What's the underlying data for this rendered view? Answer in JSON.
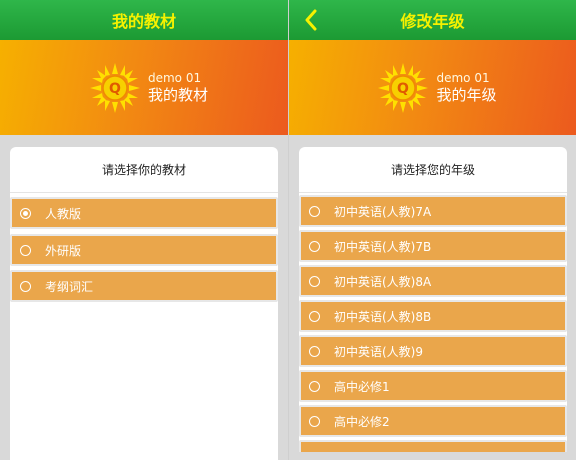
{
  "left": {
    "title": "我的教材",
    "banner": {
      "user": "demo 01",
      "subtitle": "我的教材"
    },
    "prompt": "请选择你的教材",
    "options": [
      {
        "label": "人教版",
        "selected": true
      },
      {
        "label": "外研版",
        "selected": false
      },
      {
        "label": "考纲词汇",
        "selected": false
      }
    ]
  },
  "right": {
    "title": "修改年级",
    "banner": {
      "user": "demo 01",
      "subtitle": "我的年级"
    },
    "prompt": "请选择您的年级",
    "options": [
      {
        "label": "初中英语(人教)7A",
        "selected": false
      },
      {
        "label": "初中英语(人教)7B",
        "selected": false
      },
      {
        "label": "初中英语(人教)8A",
        "selected": false
      },
      {
        "label": "初中英语(人教)8B",
        "selected": false
      },
      {
        "label": "初中英语(人教)9",
        "selected": false
      },
      {
        "label": "高中必修1",
        "selected": false
      },
      {
        "label": "高中必修2",
        "selected": false
      }
    ]
  },
  "logo_letter": "Q",
  "icons": {
    "back": "chevron-left-icon",
    "logo": "sun-logo-icon",
    "radio": "radio-icon"
  },
  "colors": {
    "titlebar": "#23a83c",
    "title_text": "#f6f100",
    "banner_start": "#f6b000",
    "banner_end": "#ec5a1e",
    "option_bg": "#eaa64b"
  }
}
